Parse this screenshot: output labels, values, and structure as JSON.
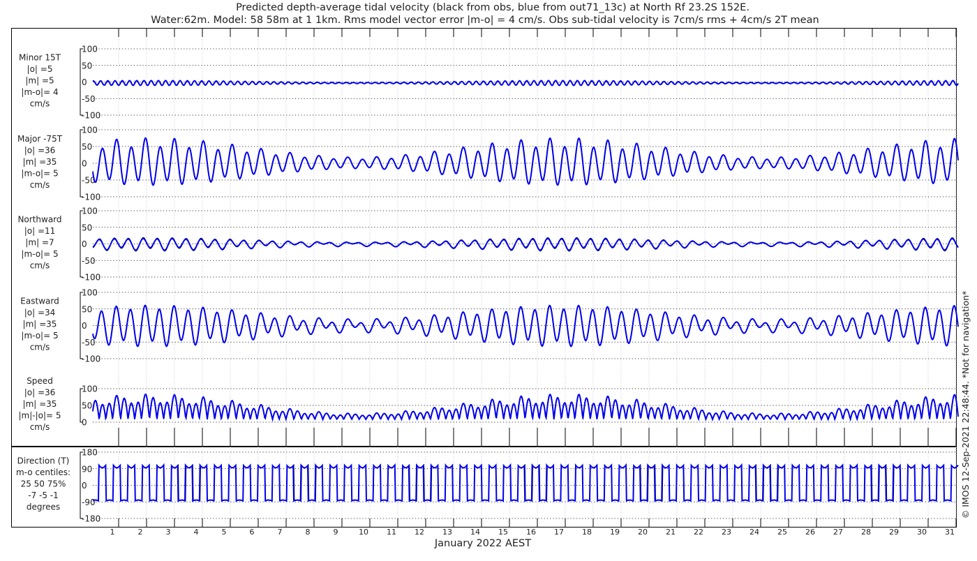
{
  "chart_data": {
    "type": "line",
    "title": [
      "Predicted depth-average tidal velocity (black from obs, blue from out71_13c) at North Rf 23.2S 152E.",
      "Water:62m. Model: 58 58m at 1 1km. Rms model vector error |m-o| = 4 cm/s. Obs sub-tidal velocity is 7cm/s rms + 4cm/s 2T mean"
    ],
    "xlabel": "January 2022 AEST",
    "x_ticks": [
      "1",
      "2",
      "3",
      "4",
      "5",
      "6",
      "7",
      "8",
      "9",
      "10",
      "11",
      "12",
      "13",
      "14",
      "15",
      "16",
      "17",
      "18",
      "19",
      "20",
      "21",
      "22",
      "23",
      "24",
      "25",
      "26",
      "27",
      "28",
      "29",
      "30",
      "31"
    ],
    "xlim_days": [
      0.3,
      31.3
    ],
    "series_legend": [
      {
        "name": "obs",
        "color": "#000000"
      },
      {
        "name": "model out71_13c",
        "color": "#0000ee"
      }
    ],
    "panels": [
      {
        "id": "minor",
        "label": [
          "Minor 15T",
          "|o| =5",
          "|m| =5",
          "|m-o|= 4",
          "cm/s"
        ],
        "ylim": [
          -100,
          100
        ],
        "yticks": [
          "100",
          "50",
          "0",
          "-50",
          "-100"
        ],
        "kind": "minor",
        "amplitude": 10
      },
      {
        "id": "major",
        "label": [
          "Major -75T",
          "|o| =36",
          "|m| =35",
          "|m-o|= 5",
          "cm/s"
        ],
        "ylim": [
          -100,
          100
        ],
        "yticks": [
          "100",
          "50",
          "0",
          "-50",
          "-100"
        ],
        "kind": "major",
        "amplitude": 58
      },
      {
        "id": "north",
        "label": [
          "Northward",
          "|o| =11",
          "|m| =7",
          "|m-o|= 5",
          "cm/s"
        ],
        "ylim": [
          -100,
          100
        ],
        "yticks": [
          "100",
          "50",
          "0",
          "-50",
          "-100"
        ],
        "kind": "north",
        "amplitude": 18
      },
      {
        "id": "east",
        "label": [
          "Eastward",
          "|o| =34",
          "|m| =35",
          "|m-o|= 5",
          "cm/s"
        ],
        "ylim": [
          -100,
          100
        ],
        "yticks": [
          "100",
          "50",
          "0",
          "-50",
          "-100"
        ],
        "kind": "east",
        "amplitude": 55
      },
      {
        "id": "speed",
        "label": [
          "Speed",
          "|o| =36",
          "|m| =35",
          "|m|-|o|= 5",
          "cm/s"
        ],
        "ylim": [
          0,
          100
        ],
        "yticks": [
          "100",
          "50",
          "0"
        ],
        "kind": "speed",
        "amplitude": 58
      },
      {
        "id": "direction",
        "label": [
          "Direction (T)",
          "m-o centiles:",
          "25  50  75%",
          "-7 -5 -1",
          "degrees"
        ],
        "ylim": [
          -180,
          180
        ],
        "yticks": [
          "180",
          "90",
          "0",
          "-90",
          "-180"
        ],
        "kind": "direction",
        "amplitude": 90
      }
    ],
    "tidal_period_hours": 12.42,
    "spring_neap_period_days": 14.77,
    "grid": true
  },
  "footer": {
    "copyright": "© IMOS 12-Sep-2021 22:48:44. *Not for navigation*"
  },
  "colors": {
    "obs": "#000000",
    "model": "#0000ee",
    "grid": "#9999bb"
  }
}
